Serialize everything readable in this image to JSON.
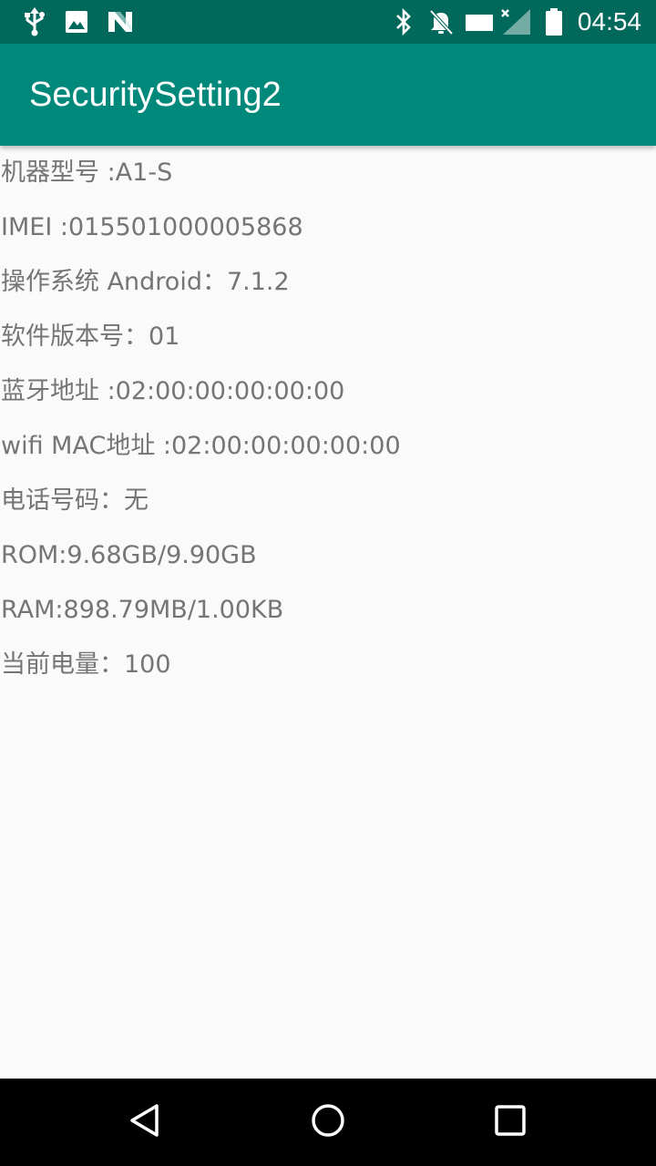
{
  "status_bar": {
    "time": "04:54",
    "left_icons": [
      "usb-icon",
      "image-notification-icon",
      "n-notification-icon"
    ],
    "right_icons": [
      "bluetooth-icon",
      "notifications-off-icon",
      "wifi-no-connection-icon",
      "signal-icon",
      "battery-full-icon"
    ]
  },
  "app_bar": {
    "title": "SecuritySetting2"
  },
  "info": {
    "model": "机器型号 :A1-S",
    "imei": "IMEI :015501000005868",
    "os": "操作系统 Android：7.1.2",
    "software_version": "软件版本号：01",
    "bluetooth_address": "蓝牙地址 :02:00:00:00:00:00",
    "wifi_mac": "wifi MAC地址 :02:00:00:00:00:00",
    "phone_number": "电话号码：无",
    "rom": "ROM:9.68GB/9.90GB",
    "ram": "RAM:898.79MB/1.00KB",
    "battery": "当前电量：100"
  },
  "colors": {
    "status_bar": "#00695c",
    "app_bar": "#00897b",
    "background": "#fafafa",
    "text": "#757575",
    "nav_bar": "#000000"
  },
  "nav_bar": {
    "buttons": [
      "back-icon",
      "home-icon",
      "recents-icon"
    ]
  }
}
